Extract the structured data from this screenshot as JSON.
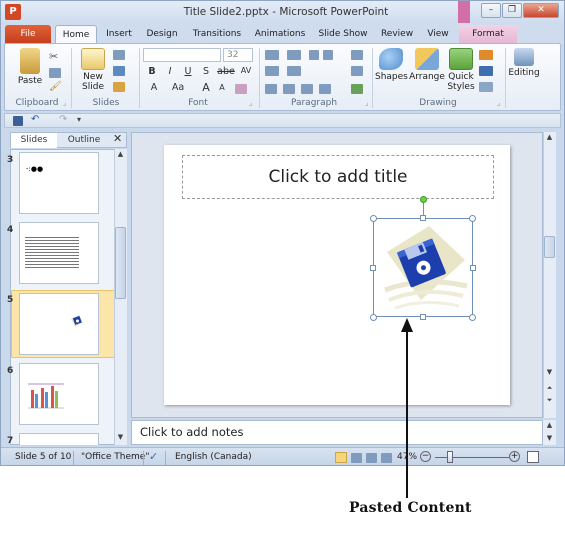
{
  "window": {
    "title": "Title Slide2.pptx - Microsoft PowerPoint",
    "app_icon_letter": "P",
    "controls": {
      "minimize": "–",
      "restore": "❐",
      "close": "✕"
    }
  },
  "ribbon": {
    "tabs": [
      "File",
      "Home",
      "Insert",
      "Design",
      "Transitions",
      "Animations",
      "Slide Show",
      "Review",
      "View",
      "Format"
    ],
    "active_tab": "Home",
    "help": "?",
    "groups": {
      "clipboard": {
        "label": "Clipboard",
        "paste": "Paste"
      },
      "slides": {
        "label": "Slides",
        "new_slide_line1": "New",
        "new_slide_line2": "Slide"
      },
      "font": {
        "label": "Font",
        "size": "32",
        "buttons": [
          "B",
          "I",
          "U",
          "S",
          "abe",
          "AV"
        ],
        "row3": [
          "A",
          "Aa",
          "A",
          "A"
        ]
      },
      "paragraph": {
        "label": "Paragraph"
      },
      "drawing": {
        "label": "Drawing",
        "shapes": "Shapes",
        "arrange": "Arrange",
        "quick_styles_line1": "Quick",
        "quick_styles_line2": "Styles"
      },
      "editing": {
        "label": "Editing"
      }
    },
    "colors": {
      "file_tab": "#d24726",
      "format_tab": "#e4b5d3"
    }
  },
  "slides_pane": {
    "tabs": [
      "Slides",
      "Outline"
    ],
    "close": "✕",
    "thumbnails": [
      {
        "number": "3",
        "text": "-:●●"
      },
      {
        "number": "4"
      },
      {
        "number": "5",
        "selected": true
      },
      {
        "number": "6"
      },
      {
        "number": "7"
      }
    ]
  },
  "slide": {
    "title_placeholder": "Click to add title"
  },
  "notes": {
    "placeholder": "Click to add notes"
  },
  "status_bar": {
    "slide_position": "Slide 5 of 10",
    "theme": "\"Office Theme\"",
    "language": "English (Canada)",
    "zoom": "47%",
    "zoom_level": 0.47
  },
  "annotation": {
    "callout": "Pasted Content"
  }
}
